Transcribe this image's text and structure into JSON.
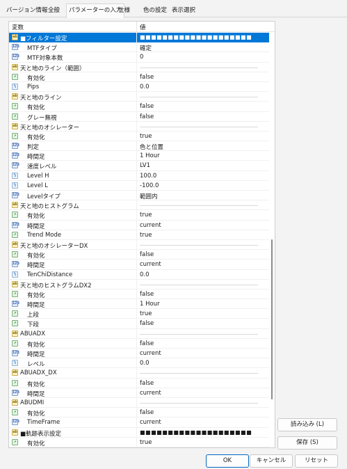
{
  "tabs": [
    {
      "label": "バージョン情報"
    },
    {
      "label": "全般"
    },
    {
      "label": "パラメーターの入力"
    },
    {
      "label": "仕様"
    },
    {
      "label": "色の設定"
    },
    {
      "label": "表示選択"
    }
  ],
  "table": {
    "col_variable": "変数",
    "col_value": "値",
    "rows": [
      {
        "icon": "abc",
        "name": "■フィルター設定",
        "value": "■■■■■■■■■■■■■■■■■■■■",
        "level": 0,
        "selected": true
      },
      {
        "icon": "int",
        "name": "MTFタイプ",
        "value": "確定",
        "level": 1
      },
      {
        "icon": "int",
        "name": "MTF対象本数",
        "value": "0",
        "level": 1
      },
      {
        "icon": "abc",
        "name": "天と地のライン（範囲）",
        "value": "",
        "level": 0,
        "divider": true
      },
      {
        "icon": "bool",
        "name": "有効化",
        "value": "false",
        "level": 1
      },
      {
        "icon": "dbl",
        "name": "Pips",
        "value": "0.0",
        "level": 1
      },
      {
        "icon": "abc",
        "name": "天と地のライン",
        "value": "",
        "level": 0,
        "divider": true
      },
      {
        "icon": "bool",
        "name": "有効化",
        "value": "false",
        "level": 1
      },
      {
        "icon": "bool",
        "name": "グレー無視",
        "value": "false",
        "level": 1
      },
      {
        "icon": "abc",
        "name": "天と地のオシレーター",
        "value": "",
        "level": 0,
        "divider": true
      },
      {
        "icon": "bool",
        "name": "有効化",
        "value": "true",
        "level": 1
      },
      {
        "icon": "int",
        "name": "判定",
        "value": "色と位置",
        "level": 1
      },
      {
        "icon": "int",
        "name": "時間足",
        "value": "1 Hour",
        "level": 1
      },
      {
        "icon": "int",
        "name": "速度レベル",
        "value": "LV1",
        "level": 1
      },
      {
        "icon": "dbl",
        "name": "Level H",
        "value": "100.0",
        "level": 1
      },
      {
        "icon": "dbl",
        "name": "Level L",
        "value": "-100.0",
        "level": 1
      },
      {
        "icon": "int",
        "name": "Levelタイプ",
        "value": "範囲内",
        "level": 1
      },
      {
        "icon": "abc",
        "name": "天と地のヒストグラム",
        "value": "",
        "level": 0,
        "divider": true
      },
      {
        "icon": "bool",
        "name": "有効化",
        "value": "true",
        "level": 1
      },
      {
        "icon": "int",
        "name": "時間足",
        "value": "current",
        "level": 1
      },
      {
        "icon": "bool",
        "name": "Trend Mode",
        "value": "true",
        "level": 1
      },
      {
        "icon": "abc",
        "name": "天と地のオシレーターDX",
        "value": "",
        "level": 0,
        "divider": true
      },
      {
        "icon": "bool",
        "name": "有効化",
        "value": "false",
        "level": 1
      },
      {
        "icon": "int",
        "name": "時間足",
        "value": "current",
        "level": 1
      },
      {
        "icon": "dbl",
        "name": "TenChiDistance",
        "value": "0.0",
        "level": 1
      },
      {
        "icon": "abc",
        "name": "天と地のヒストグラムDX2",
        "value": "",
        "level": 0,
        "divider": true
      },
      {
        "icon": "bool",
        "name": "有効化",
        "value": "false",
        "level": 1
      },
      {
        "icon": "int",
        "name": "時間足",
        "value": "1 Hour",
        "level": 1
      },
      {
        "icon": "bool",
        "name": "上段",
        "value": "true",
        "level": 1
      },
      {
        "icon": "bool",
        "name": "下段",
        "value": "false",
        "level": 1
      },
      {
        "icon": "abc",
        "name": "ABUADX",
        "value": "",
        "level": 0,
        "divider": true
      },
      {
        "icon": "bool",
        "name": "有効化",
        "value": "false",
        "level": 1
      },
      {
        "icon": "int",
        "name": "時間足",
        "value": "current",
        "level": 1
      },
      {
        "icon": "dbl",
        "name": "レベル",
        "value": "0.0",
        "level": 1
      },
      {
        "icon": "abc",
        "name": "ABUADX_DX",
        "value": "",
        "level": 0,
        "divider": true
      },
      {
        "icon": "bool",
        "name": "有効化",
        "value": "false",
        "level": 1
      },
      {
        "icon": "int",
        "name": "時間足",
        "value": "current",
        "level": 1
      },
      {
        "icon": "abc",
        "name": "ABUDMI",
        "value": "",
        "level": 0,
        "divider": true
      },
      {
        "icon": "bool",
        "name": "有効化",
        "value": "false",
        "level": 1
      },
      {
        "icon": "int",
        "name": "TimeFrame",
        "value": "current",
        "level": 1
      },
      {
        "icon": "abc",
        "name": "■軌跡表示設定",
        "value": "■■■■■■■■■■■■■■■■■■■■",
        "level": 0,
        "blocks": true
      },
      {
        "icon": "bool",
        "name": "有効化",
        "value": "true",
        "level": 1
      }
    ]
  },
  "icon_glyphs": {
    "abc": "ab",
    "bool": "↗",
    "int": "123",
    "dbl": "½"
  },
  "buttons": {
    "load": "読み込み (L)",
    "save": "保存 (S)",
    "ok": "OK",
    "cancel": "キャンセル",
    "reset": "リセット"
  },
  "colors": {
    "selected": "#0078d7",
    "primary_border": "#0067c0"
  }
}
